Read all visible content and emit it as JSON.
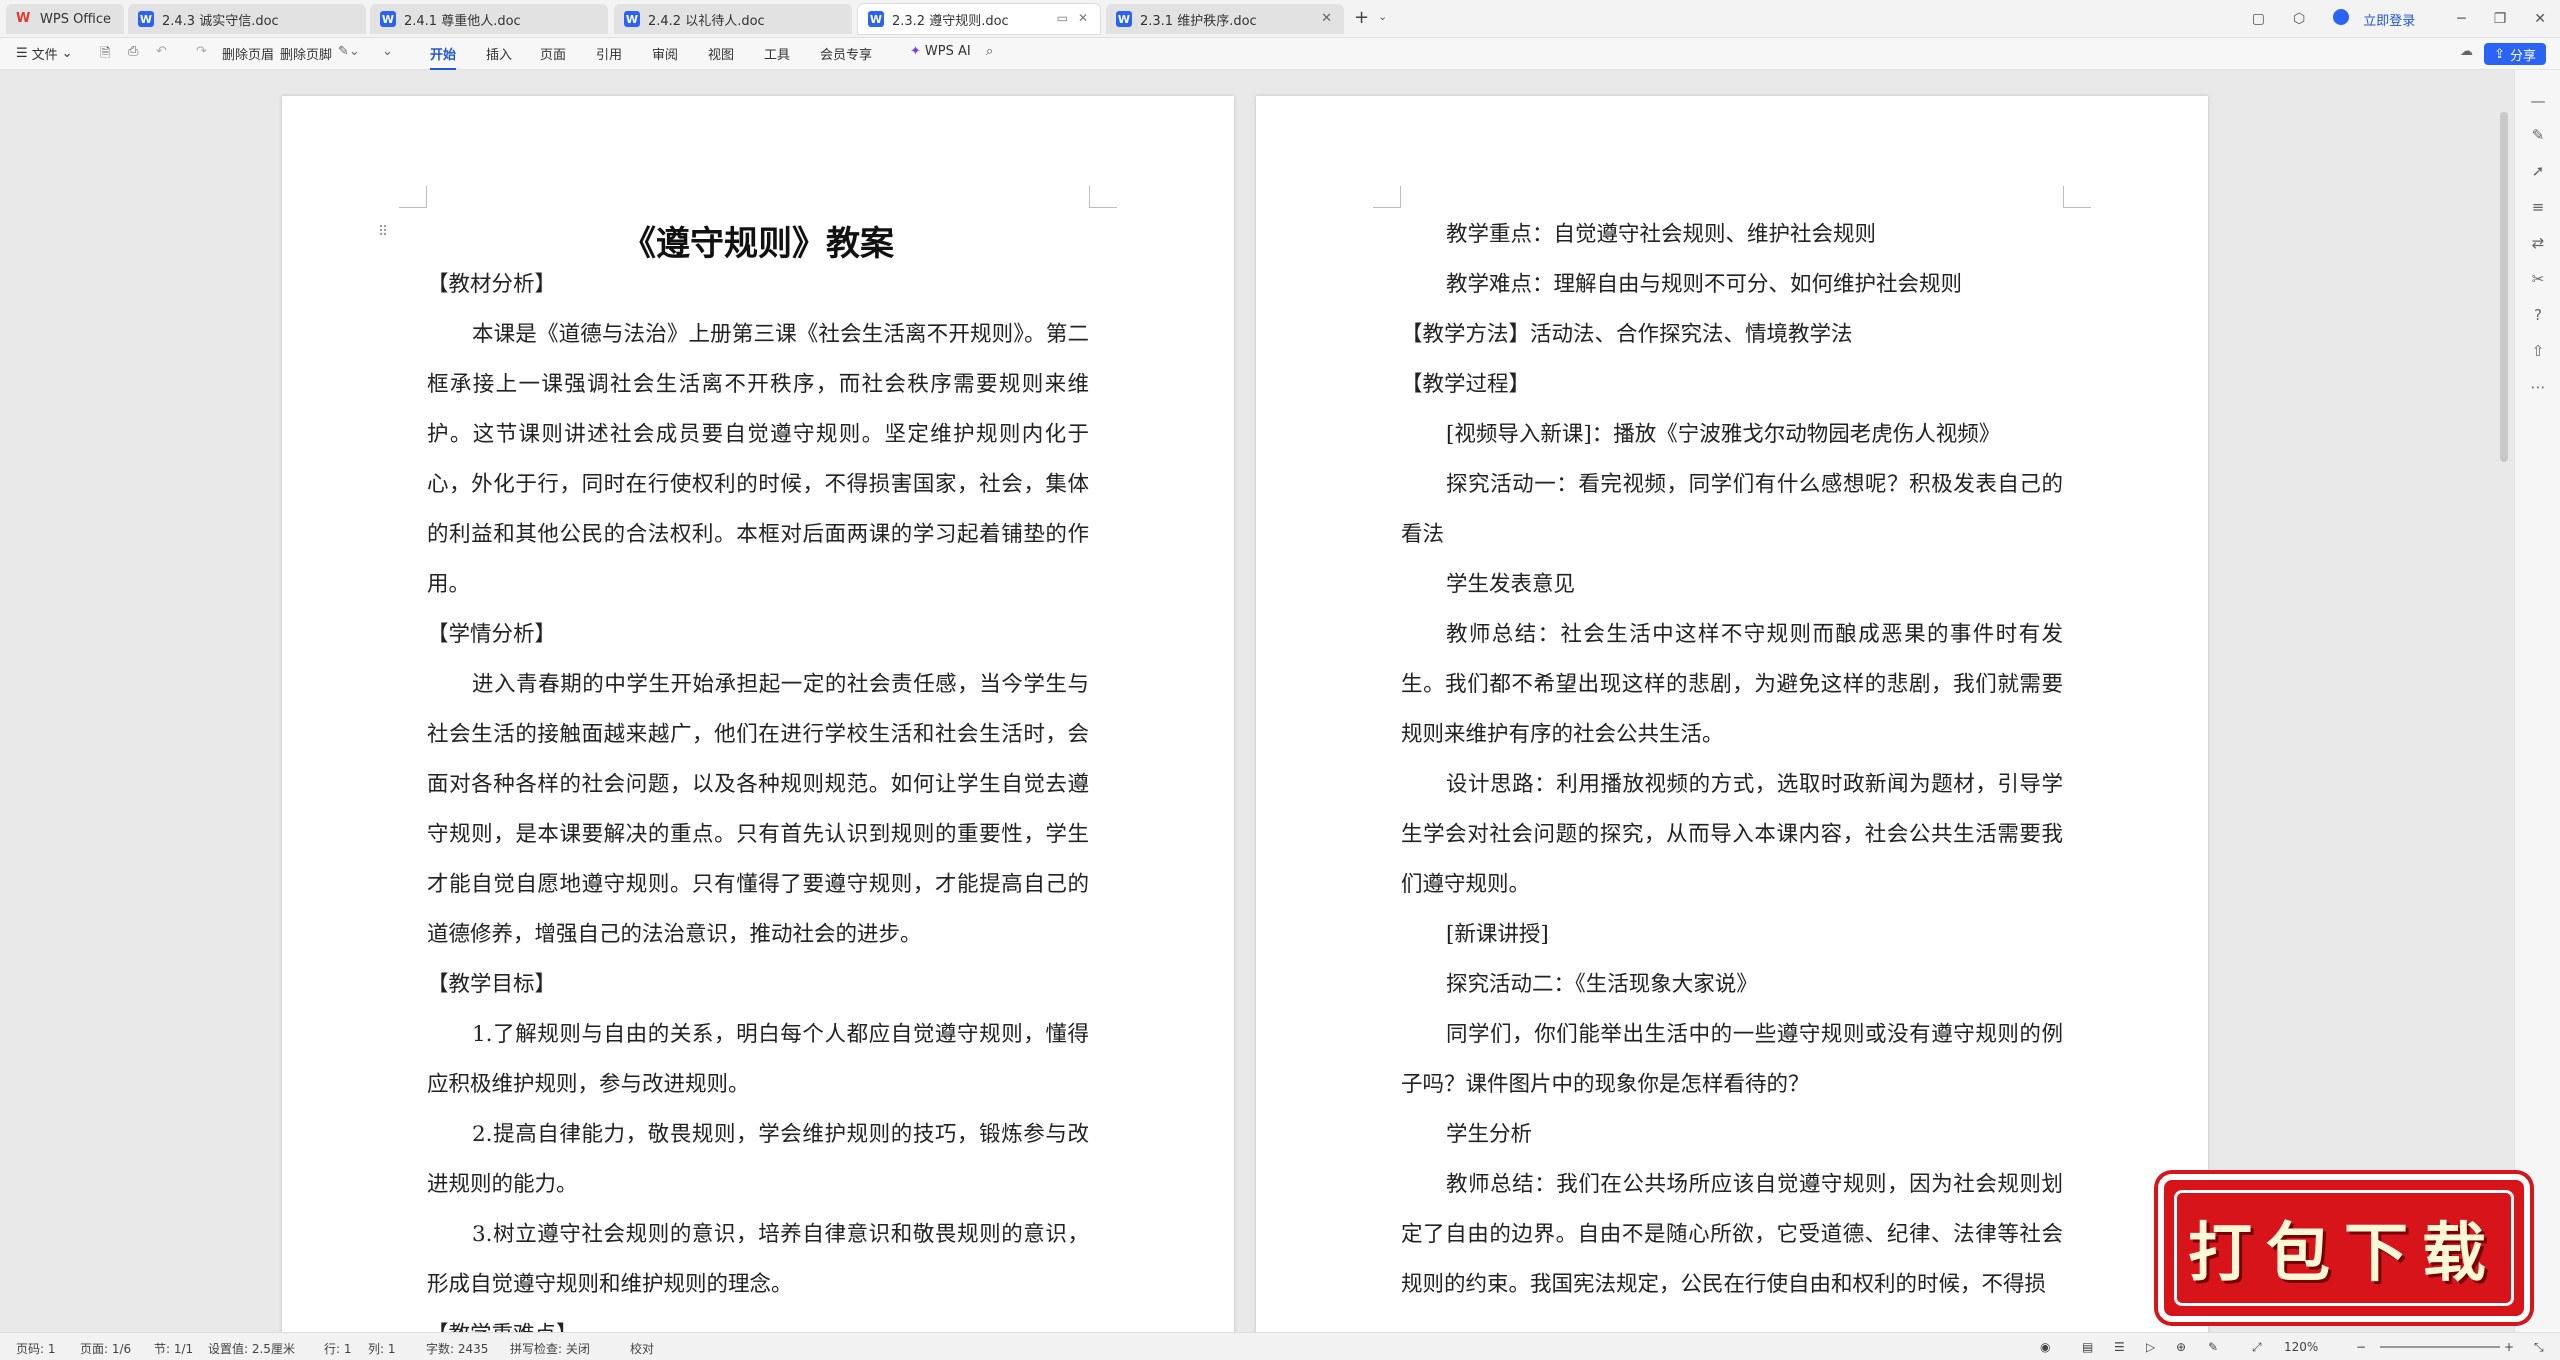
{
  "tabs": [
    {
      "label": "WPS Office",
      "kind": "wps"
    },
    {
      "label": "2.4.3 诚实守信.doc",
      "kind": "doc"
    },
    {
      "label": "2.4.1 尊重他人.doc",
      "kind": "doc"
    },
    {
      "label": "2.4.2 以礼待人.doc",
      "kind": "doc"
    },
    {
      "label": "2.3.2 遵守规则.doc",
      "kind": "doc"
    },
    {
      "label": "2.3.1 维护秩序.doc",
      "kind": "doc"
    }
  ],
  "window": {
    "login": "立即登录"
  },
  "toolbar": {
    "file": "文件",
    "delete_header": "删除页眉",
    "delete_footer": "删除页脚",
    "menus": [
      "开始",
      "插入",
      "页面",
      "引用",
      "审阅",
      "视图",
      "工具",
      "会员专享"
    ],
    "ai": "WPS AI",
    "share": "分享"
  },
  "doc": {
    "title": "《遵守规则》教案",
    "left": [
      {
        "t": "【教材分析】",
        "ind": false
      },
      {
        "t": "本课是《道德与法治》上册第三课《社会生活离不开规则》。第二框承接上一课强调社会生活离不开秩序，而社会秩序需要规则来维护。这节课则讲述社会成员要自觉遵守规则。坚定维护规则内化于心，外化于行，同时在行使权利的时候，不得损害国家，社会，集体的利益和其他公民的合法权利。本框对后面两课的学习起着铺垫的作用。",
        "ind": true
      },
      {
        "t": "【学情分析】",
        "ind": false
      },
      {
        "t": "进入青春期的中学生开始承担起一定的社会责任感，当今学生与社会生活的接触面越来越广，他们在进行学校生活和社会生活时，会面对各种各样的社会问题，以及各种规则规范。如何让学生自觉去遵守规则，是本课要解决的重点。只有首先认识到规则的重要性，学生才能自觉自愿地遵守规则。只有懂得了要遵守规则，才能提高自己的道德修养，增强自己的法治意识，推动社会的进步。",
        "ind": true
      },
      {
        "t": "【教学目标】",
        "ind": false
      },
      {
        "t": "1.了解规则与自由的关系，明白每个人都应自觉遵守规则，懂得应积极维护规则，参与改进规则。",
        "ind": true
      },
      {
        "t": "2.提高自律能力，敬畏规则，学会维护规则的技巧，锻炼参与改进规则的能力。",
        "ind": true
      },
      {
        "t": "3.树立遵守社会规则的意识，培养自律意识和敬畏规则的意识，形成自觉遵守规则和维护规则的理念。",
        "ind": true
      },
      {
        "t": "【教学重难点】",
        "ind": false
      }
    ],
    "right": [
      {
        "t": "教学重点：自觉遵守社会规则、维护社会规则",
        "ind": true
      },
      {
        "t": "教学难点：理解自由与规则不可分、如何维护社会规则",
        "ind": true
      },
      {
        "t": "【教学方法】活动法、合作探究法、情境教学法",
        "ind": false
      },
      {
        "t": "【教学过程】",
        "ind": false
      },
      {
        "t": "[视频导入新课]：播放《宁波雅戈尔动物园老虎伤人视频》",
        "ind": true
      },
      {
        "t": "探究活动一：看完视频，同学们有什么感想呢？积极发表自己的看法",
        "ind": true
      },
      {
        "t": "学生发表意见",
        "ind": true
      },
      {
        "t": "教师总结：社会生活中这样不守规则而酿成恶果的事件时有发生。我们都不希望出现这样的悲剧，为避免这样的悲剧，我们就需要规则来维护有序的社会公共生活。",
        "ind": true
      },
      {
        "t": "设计思路：利用播放视频的方式，选取时政新闻为题材，引导学生学会对社会问题的探究，从而导入本课内容，社会公共生活需要我们遵守规则。",
        "ind": true
      },
      {
        "t": "[新课讲授]",
        "ind": true
      },
      {
        "t": "探究活动二：《生活现象大家说》",
        "ind": true
      },
      {
        "t": "同学们，你们能举出生活中的一些遵守规则或没有遵守规则的例子吗？课件图片中的现象你是怎样看待的？",
        "ind": true
      },
      {
        "t": "学生分析",
        "ind": true
      },
      {
        "t": "教师总结：我们在公共场所应该自觉遵守规则，因为社会规则划定了自由的边界。自由不是随心所欲，它受道德、纪律、法律等社会规则的约束。我国宪法规定，公民在行使自由和权利的时候，不得损",
        "ind": true
      }
    ]
  },
  "status": {
    "page_num": "页码: 1",
    "pages": "页面: 1/6",
    "section": "节: 1/1",
    "setting": "设置值: 2.5厘米",
    "row": "行: 1",
    "col": "列: 1",
    "words": "字数: 2435",
    "spell": "拼写检查: 关闭",
    "proof": "校对",
    "zoom": "120%"
  },
  "promo": {
    "label": "打包下载"
  },
  "colors": {
    "accent": "#2b63f6",
    "promo": "#d7141a"
  }
}
